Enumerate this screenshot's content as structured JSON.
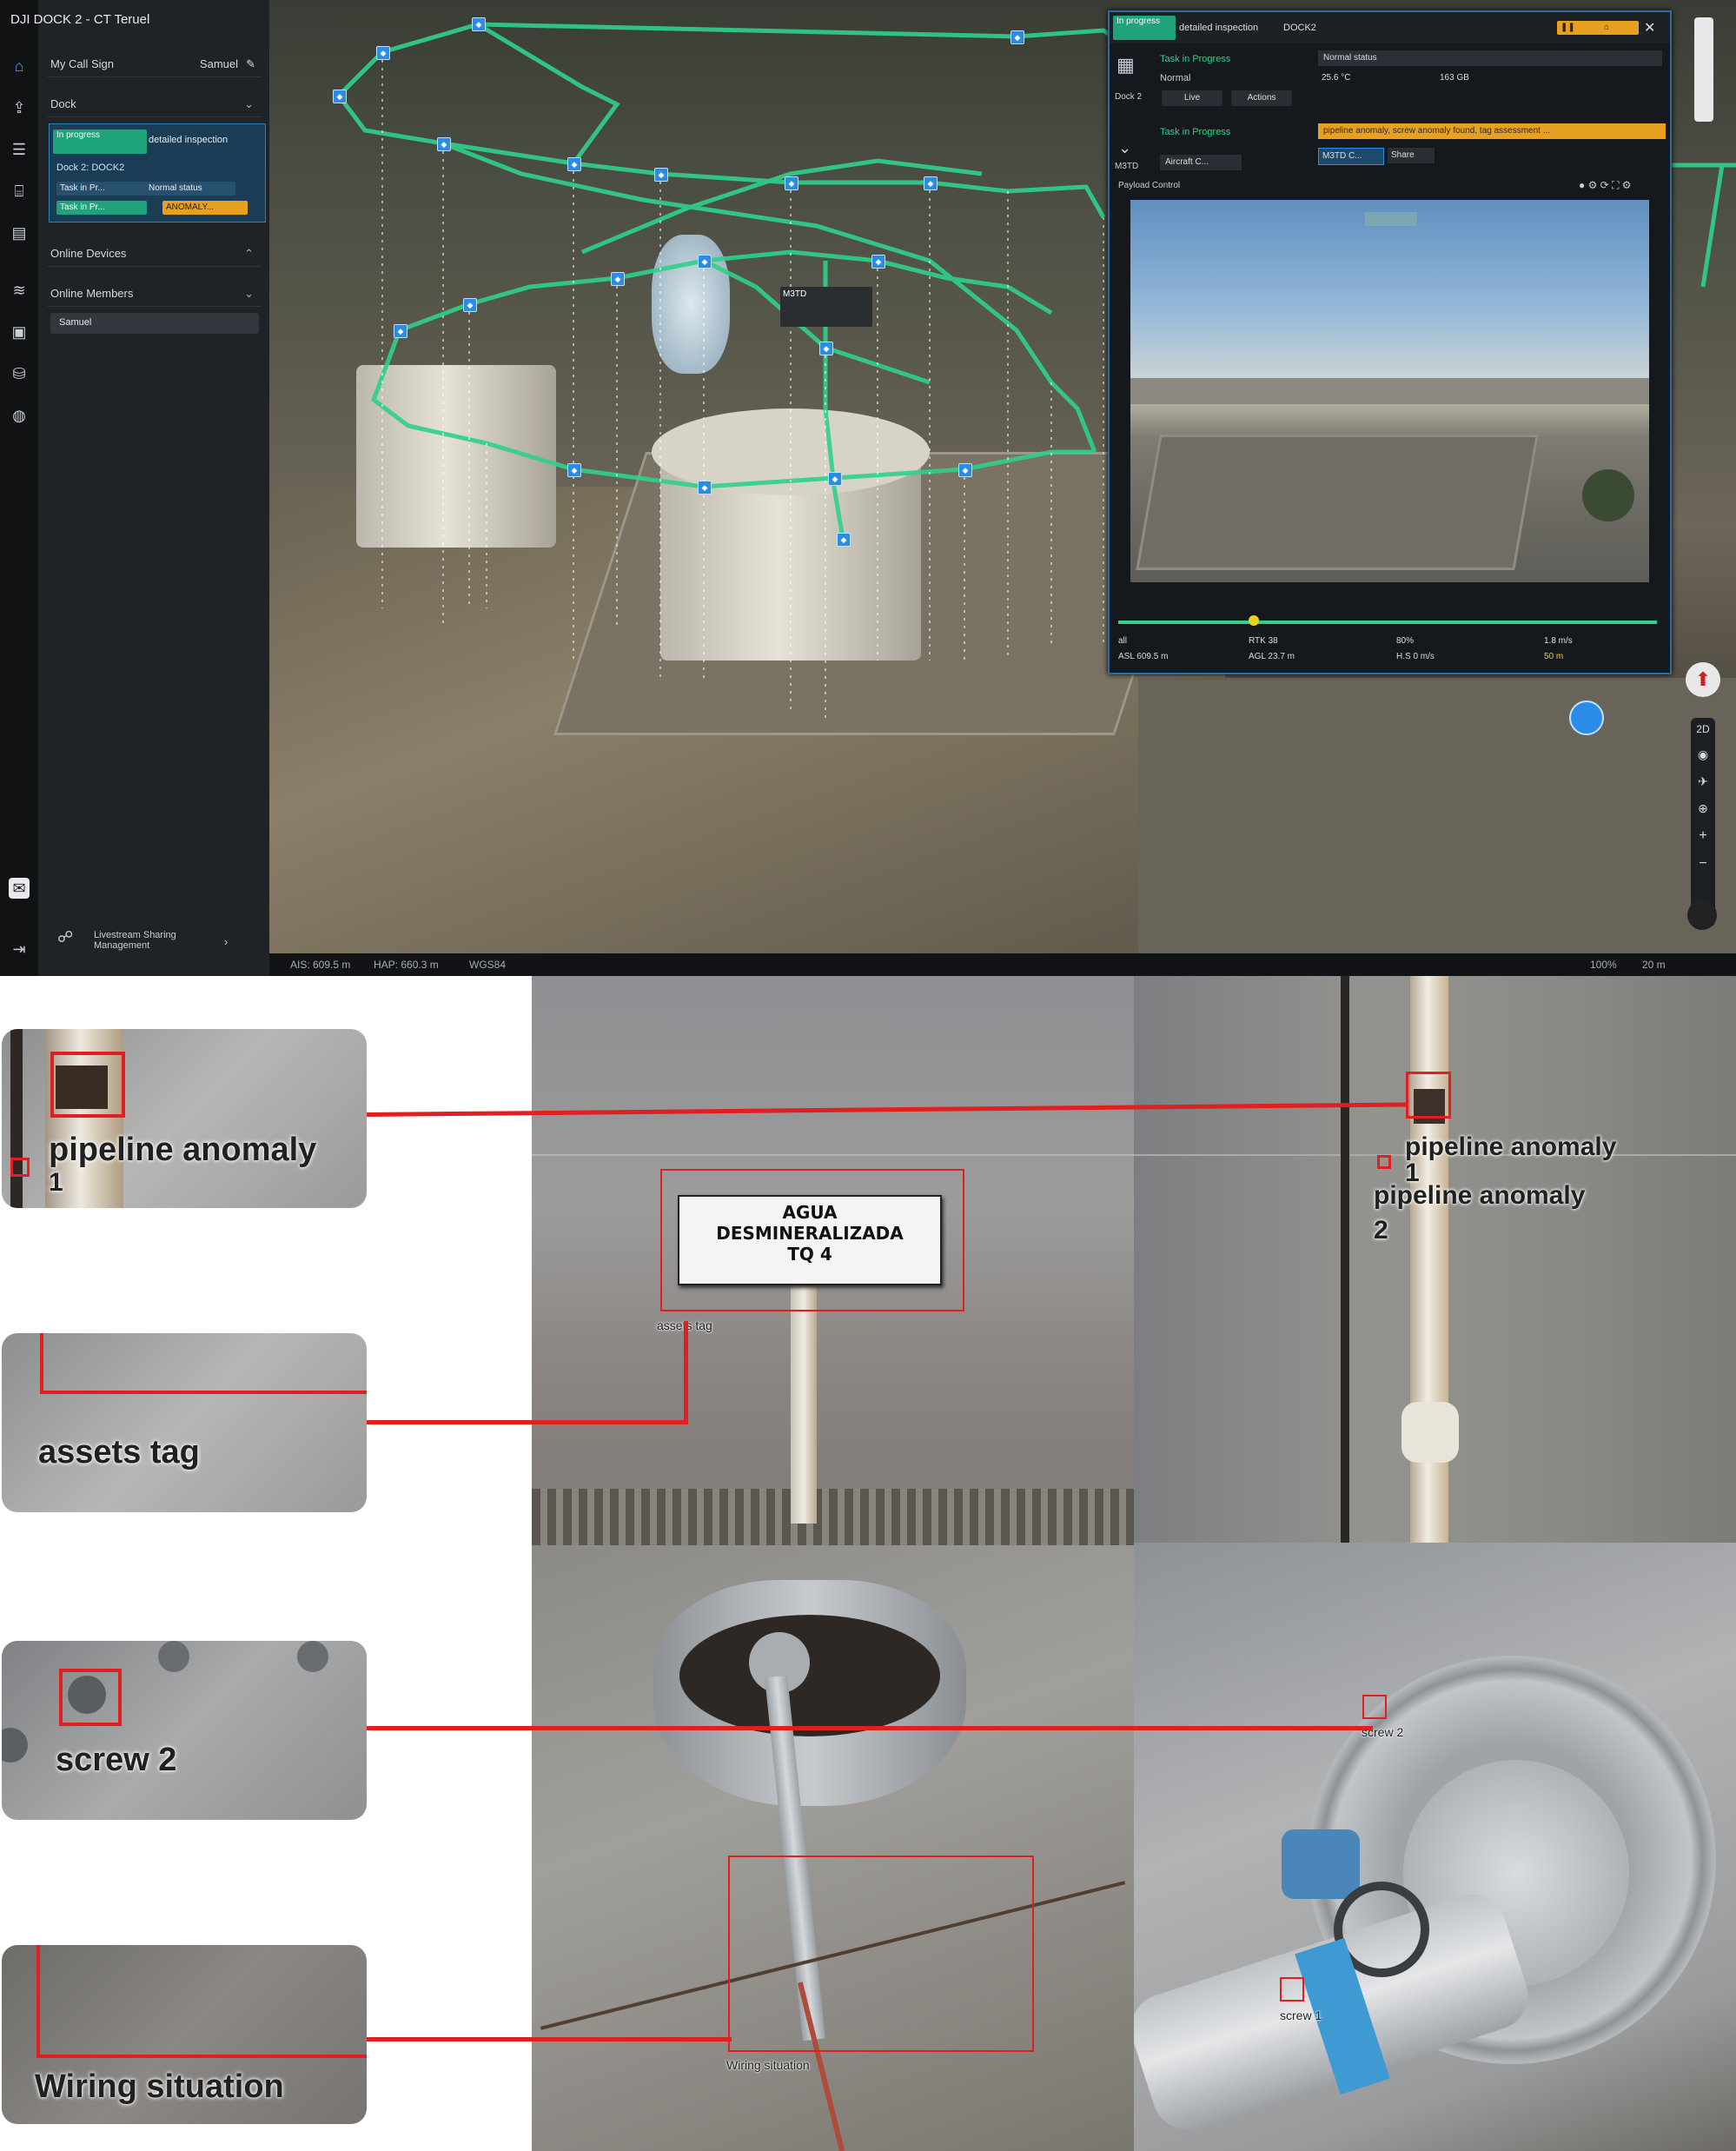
{
  "app": {
    "title": "DJI DOCK 2 - CT Teruel",
    "call_sign_label": "My Call Sign",
    "call_sign_value": "Samuel",
    "dock_label": "Dock",
    "dock_status": "In progress",
    "dock_task": "detailed inspection",
    "dock_name": "Dock 2: DOCK2",
    "dock_row1_status": "Task in Pr...",
    "dock_row1_value": "Normal status",
    "dock_row2_status": "Task in Pr...",
    "dock_row2_value": "ANOMALY...",
    "online_devices_label": "Online Devices",
    "online_members_label": "Online Members",
    "member_name": "Samuel",
    "livestream_label": "Livestream Sharing Management",
    "map_label_title": "M3TD",
    "statusbar": {
      "alt": "AIS: 609.5 m",
      "hap": "HAP: 660.3 m",
      "coords": "WGS84",
      "zoom": "100%",
      "scale": "20 m"
    }
  },
  "panel": {
    "status_badge": "In progress",
    "task_name": "detailed inspection",
    "device": "DOCK2",
    "dock_label": "Dock 2",
    "dock_status": "Task in Progress",
    "dock_sub": "Normal",
    "live_btn": "Live",
    "actions_btn": "Actions",
    "normal_status": "Normal status",
    "temp": "25.6 °C",
    "storage": "163 GB",
    "aircraft_label": "M3TD",
    "aircraft_status": "Task in Progress",
    "alert_text": "pipeline anomaly, screw anomaly found, tag assessment ...",
    "aircraft_btn": "Aircraft C...",
    "m3td_btn": "M3TD C...",
    "share_btn": "Share",
    "payload_label": "Payload Control",
    "telemetry": {
      "signal": "all",
      "asl": "ASL 609.5 m",
      "rtk": "RTK 38",
      "alt": "AGL 23.7 m",
      "battery": "80%",
      "hs": "H.S 0 m/s",
      "speed": "1.8 m/s",
      "dist": "50 m"
    }
  },
  "callouts": [
    {
      "label": "pipeline anomaly",
      "sub": "1"
    },
    {
      "label": "assets tag"
    },
    {
      "label": "screw 2"
    },
    {
      "label": "Wiring situation"
    }
  ],
  "photos": {
    "sign_line1": "AGUA",
    "sign_line2": "DESMINERALIZADA",
    "sign_line3": "TQ 4",
    "assets_tag": "assets tag",
    "pipe1": "pipeline anomaly",
    "pipe1_num": "1",
    "pipe2": "pipeline anomaly",
    "pipe2_num": "2",
    "screw2": "screw 2",
    "screw1": "screw 1",
    "wiring": "Wiring situation"
  },
  "colors": {
    "accent_green": "#1fa37a",
    "route_green": "#2fd18b",
    "poi_blue": "#2b8ce8",
    "alert_orange": "#e8a021",
    "annotation_red": "#e02020",
    "panel_border": "#2a6aa8"
  }
}
